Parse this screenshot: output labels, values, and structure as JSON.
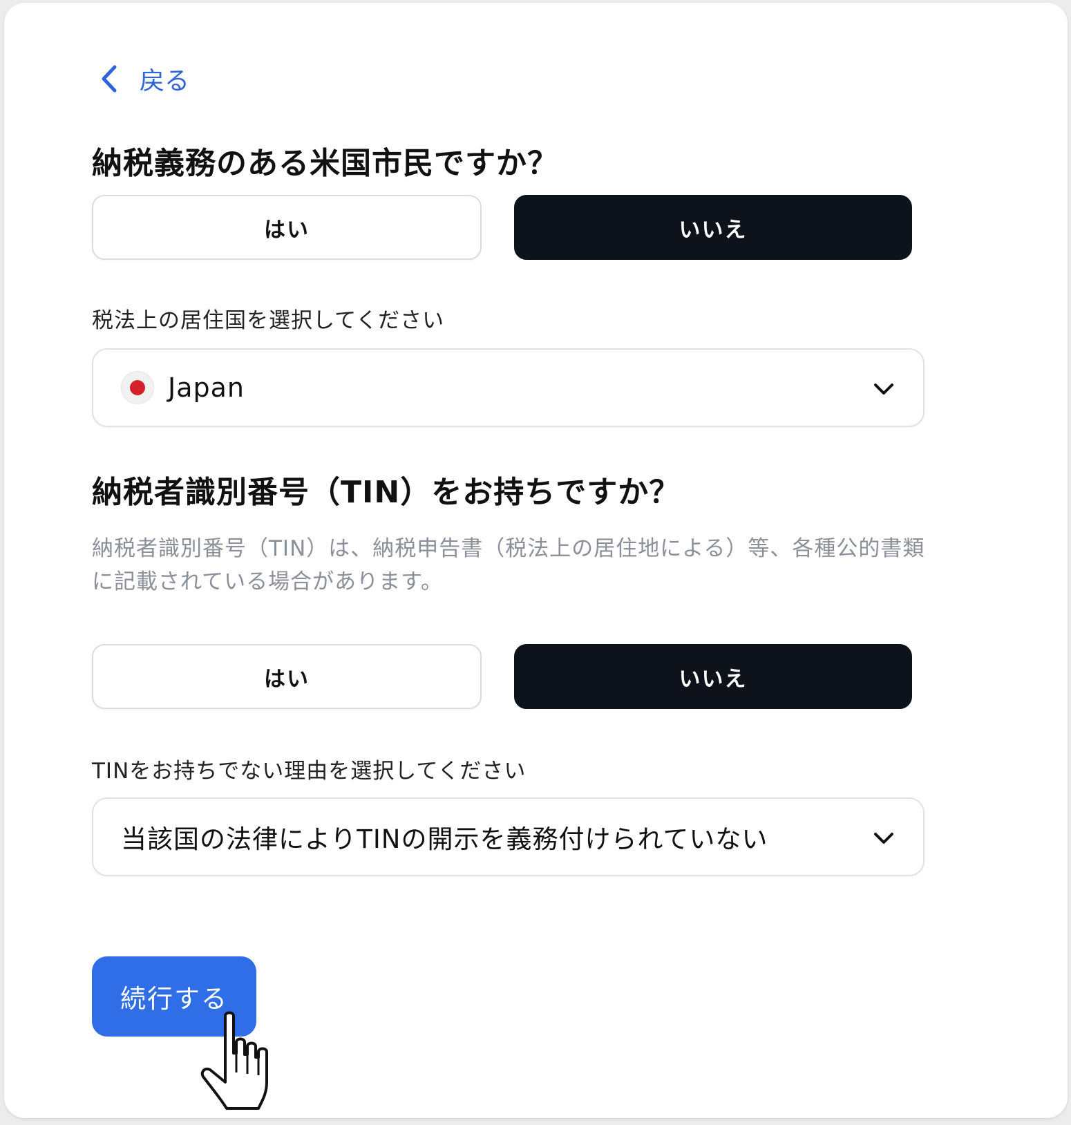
{
  "nav": {
    "back_label": "戻る"
  },
  "section1": {
    "question": "納税義務のある米国市民ですか？",
    "yes_label": "はい",
    "no_label": "いいえ",
    "selected": "no"
  },
  "residence": {
    "label": "税法上の居住国を選択してください",
    "value": "Japan",
    "flag_color": "#d32029"
  },
  "section2": {
    "question": "納税者識別番号（TIN）をお持ちですか？",
    "description": "納税者識別番号（TIN）は、納税申告書（税法上の居住地による）等、各種公的書類に記載されている場合があります。",
    "yes_label": "はい",
    "no_label": "いいえ",
    "selected": "no"
  },
  "reason": {
    "label": "TINをお持ちでない理由を選択してください",
    "value": "当該国の法律によりTINの開示を義務付けられていない"
  },
  "actions": {
    "continue_label": "続行する"
  },
  "colors": {
    "primary": "#2f6ee6",
    "dark": "#0e121a",
    "link": "#2f64d8"
  }
}
